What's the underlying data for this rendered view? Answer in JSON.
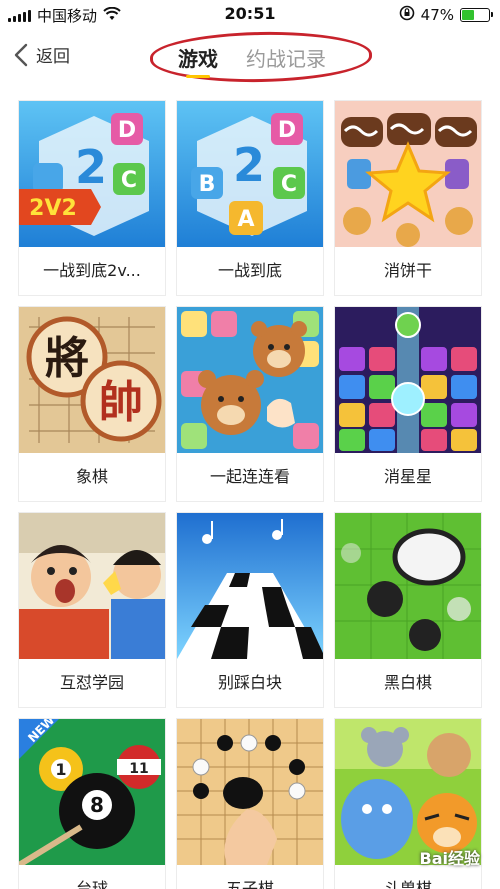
{
  "status_bar": {
    "carrier": "中国移动",
    "time": "20:51",
    "battery_percent": "47%",
    "battery_level": 0.47,
    "wifi_icon": "wifi-icon",
    "lock_icon": "rotation-lock-icon"
  },
  "header": {
    "back_label": "返回",
    "tabs": [
      {
        "label": "游戏",
        "active": true
      },
      {
        "label": "约战记录",
        "active": false
      }
    ]
  },
  "games": [
    {
      "label": "一战到底2v...",
      "badge": "2V2"
    },
    {
      "label": "一战到底"
    },
    {
      "label": "消饼干"
    },
    {
      "label": "象棋",
      "glyphs": [
        "將",
        "帥"
      ]
    },
    {
      "label": "一起连连看"
    },
    {
      "label": "消星星"
    },
    {
      "label": "互怼学园"
    },
    {
      "label": "别踩白块"
    },
    {
      "label": "黑白棋"
    },
    {
      "label": "台球",
      "badge": "NEW",
      "balls": [
        "1",
        "8",
        "11"
      ]
    },
    {
      "label": "五子棋"
    },
    {
      "label": "斗兽棋"
    }
  ],
  "letters": [
    "D",
    "B",
    "C",
    "A",
    "2"
  ],
  "watermark": "Bai经验",
  "colors": {
    "accent_yellow": "#ffc400",
    "annotation_red": "#c8232c",
    "battery_green": "#32c22e"
  }
}
